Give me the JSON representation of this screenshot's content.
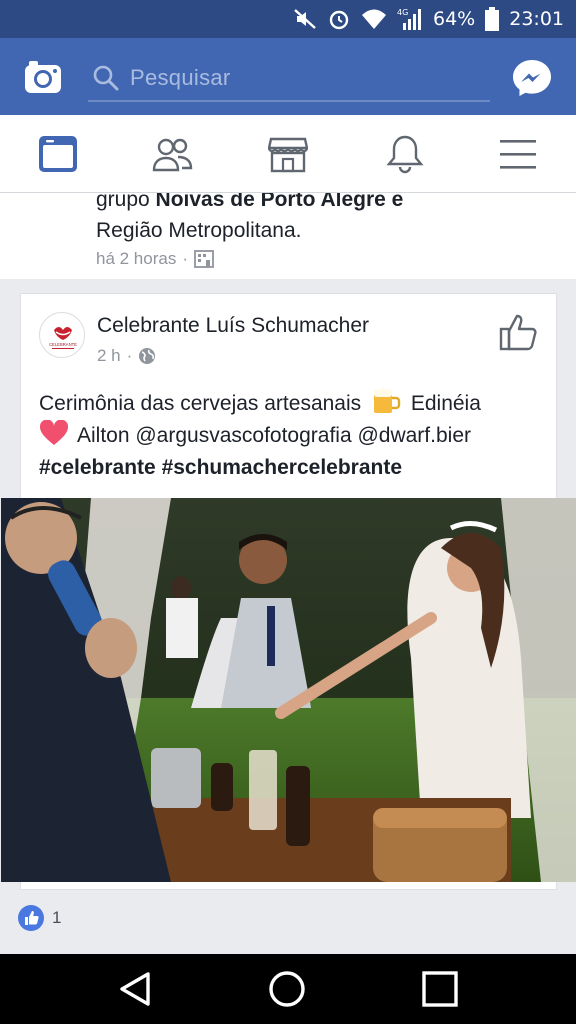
{
  "status_bar": {
    "network": "4G",
    "battery": "64%",
    "time": "23:01"
  },
  "header": {
    "search_placeholder": "Pesquisar"
  },
  "nav_tabs": [
    "feed",
    "friends",
    "marketplace",
    "notifications",
    "menu"
  ],
  "previous_post": {
    "text_start": "grupo ",
    "group_name": "Noivas de Porto Alegre e",
    "text_end": "Região Metropolitana.",
    "time": "há 2 horas"
  },
  "post": {
    "author": "Celebrante Luís Schumacher",
    "time": "2 h",
    "avatar_text": "CELEBRANTE",
    "line1_a": "Cerimônia das cervejas artesanais",
    "line1_b": "Edinéia",
    "line2": "Ailton @argusvascofotografia @dwarf.bier",
    "line3": "#celebrante #schumachercelebrante",
    "like_count": "1"
  },
  "colors": {
    "status_bar": "#2d4a85",
    "brand": "#4267b2",
    "active_tab": "#4267b2",
    "inactive_tab": "#606770"
  }
}
